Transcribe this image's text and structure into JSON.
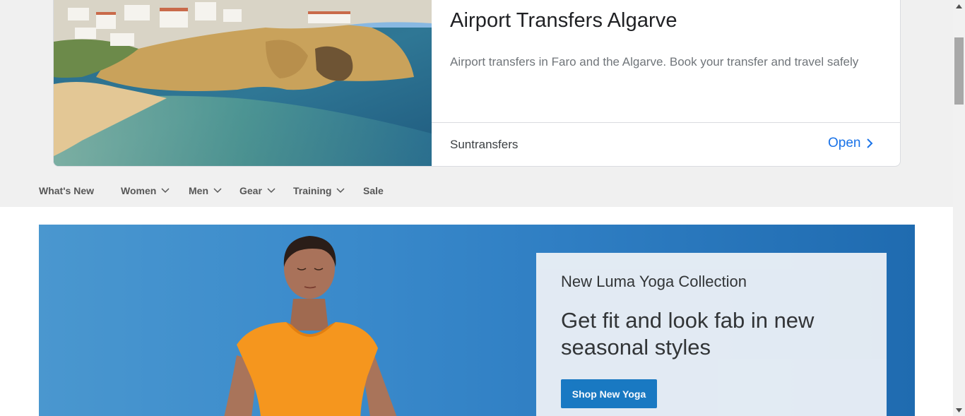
{
  "ad": {
    "title": "Airport Transfers Algarve",
    "description": "Airport transfers in Faro and the Algarve. Book your transfer and travel safely",
    "advertiser": "Suntransfers",
    "cta": "Open"
  },
  "nav": {
    "items": [
      {
        "label": "What's New",
        "dropdown": false
      },
      {
        "label": "Women",
        "dropdown": true
      },
      {
        "label": "Men",
        "dropdown": true
      },
      {
        "label": "Gear",
        "dropdown": true
      },
      {
        "label": "Training",
        "dropdown": true
      },
      {
        "label": "Sale",
        "dropdown": false
      }
    ]
  },
  "hero": {
    "eyebrow": "New Luma Yoga Collection",
    "headline": "Get fit and look fab in new seasonal styles",
    "cta": "Shop New Yoga"
  },
  "colors": {
    "accent": "#1979c3",
    "link": "#1a73e8",
    "nav_text": "#575757",
    "band": "#f0f0f0"
  }
}
